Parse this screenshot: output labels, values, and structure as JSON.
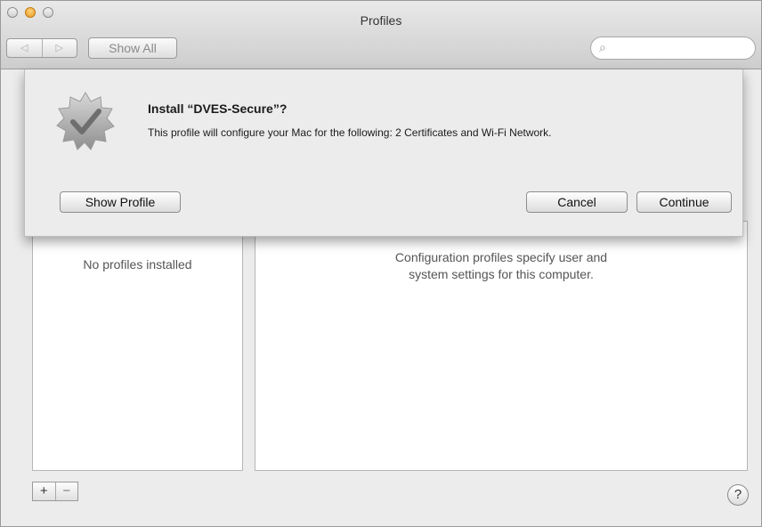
{
  "window": {
    "title": "Profiles"
  },
  "toolbar": {
    "back_icon": "◁",
    "forward_icon": "▷",
    "show_all_label": "Show All",
    "search_placeholder": ""
  },
  "sheet": {
    "title": "Install “DVES-Secure”?",
    "message": "This profile will configure your Mac for the following: 2 Certificates and Wi-Fi Network.",
    "show_profile_label": "Show Profile",
    "cancel_label": "Cancel",
    "continue_label": "Continue",
    "icon": "verified-badge-icon"
  },
  "profiles_list": {
    "empty_text": "No profiles installed"
  },
  "detail": {
    "empty_text": "Configuration profiles specify user and\nsystem settings for this computer."
  },
  "footer": {
    "add_label": "+",
    "remove_label": "−",
    "help_label": "?"
  },
  "colors": {
    "window_bg": "#ececec",
    "panel_bg": "#ffffff",
    "minimize_button": "#e59a22"
  }
}
